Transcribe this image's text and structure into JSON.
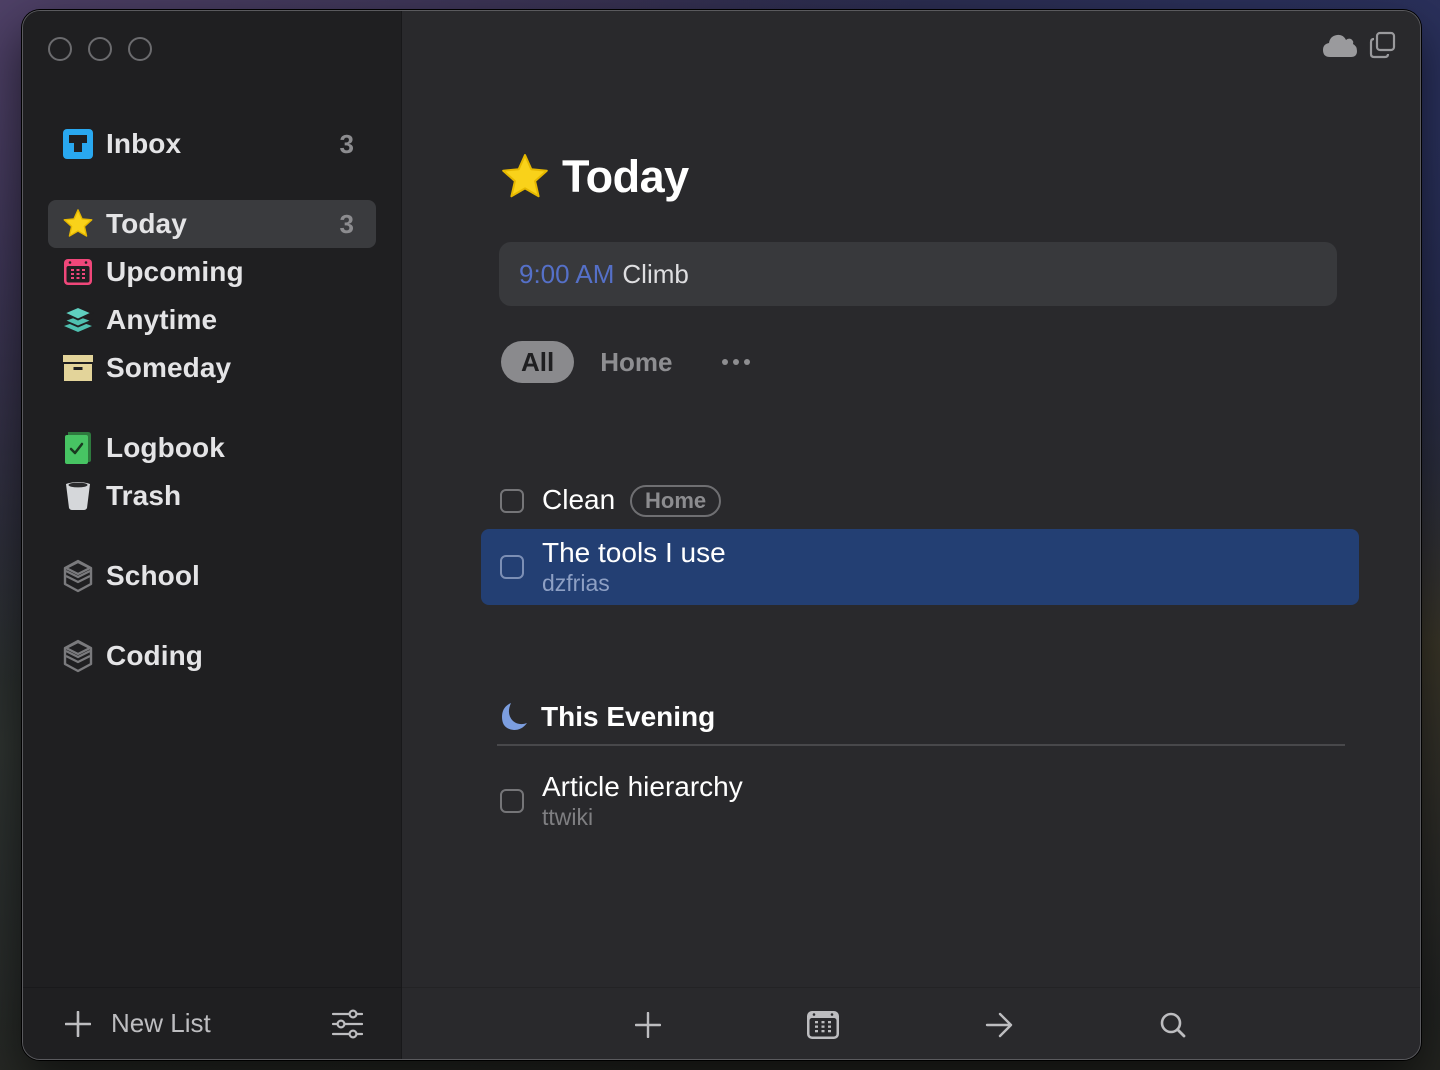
{
  "sidebar": {
    "items": [
      {
        "id": "inbox",
        "label": "Inbox",
        "count": "3",
        "icon": "inbox-icon",
        "color": "#29a8f0"
      },
      {
        "id": "today",
        "label": "Today",
        "count": "3",
        "icon": "star-icon",
        "color": "#f9d21a",
        "active": true
      },
      {
        "id": "upcoming",
        "label": "Upcoming",
        "icon": "calendar-icon",
        "color": "#f0477a"
      },
      {
        "id": "anytime",
        "label": "Anytime",
        "icon": "layers-icon",
        "color": "#4fc0b0"
      },
      {
        "id": "someday",
        "label": "Someday",
        "icon": "archive-box-icon",
        "color": "#e3d49a"
      },
      {
        "id": "logbook",
        "label": "Logbook",
        "icon": "logbook-icon",
        "color": "#47c463"
      },
      {
        "id": "trash",
        "label": "Trash",
        "icon": "trash-icon",
        "color": "#d5d7da"
      },
      {
        "id": "school",
        "label": "School",
        "icon": "area-icon",
        "color": "#7a7a7d"
      },
      {
        "id": "coding",
        "label": "Coding",
        "icon": "area-icon",
        "color": "#7a7a7d"
      }
    ],
    "footer": {
      "new_list_label": "New List"
    }
  },
  "main": {
    "title": "Today",
    "event": {
      "time": "9:00 AM",
      "name": "Climb",
      "time_color": "#5570c8"
    },
    "tag_filters": [
      {
        "label": "All",
        "active": true
      },
      {
        "label": "Home",
        "active": false
      }
    ],
    "tasks": [
      {
        "name": "Clean",
        "tag": "Home"
      },
      {
        "name": "The tools I use",
        "subtitle": "dzfrias",
        "selected": true
      }
    ],
    "evening": {
      "title": "This Evening",
      "tasks": [
        {
          "name": "Article hierarchy",
          "subtitle": "ttwiki"
        }
      ]
    },
    "selected_color": "#233f73"
  }
}
